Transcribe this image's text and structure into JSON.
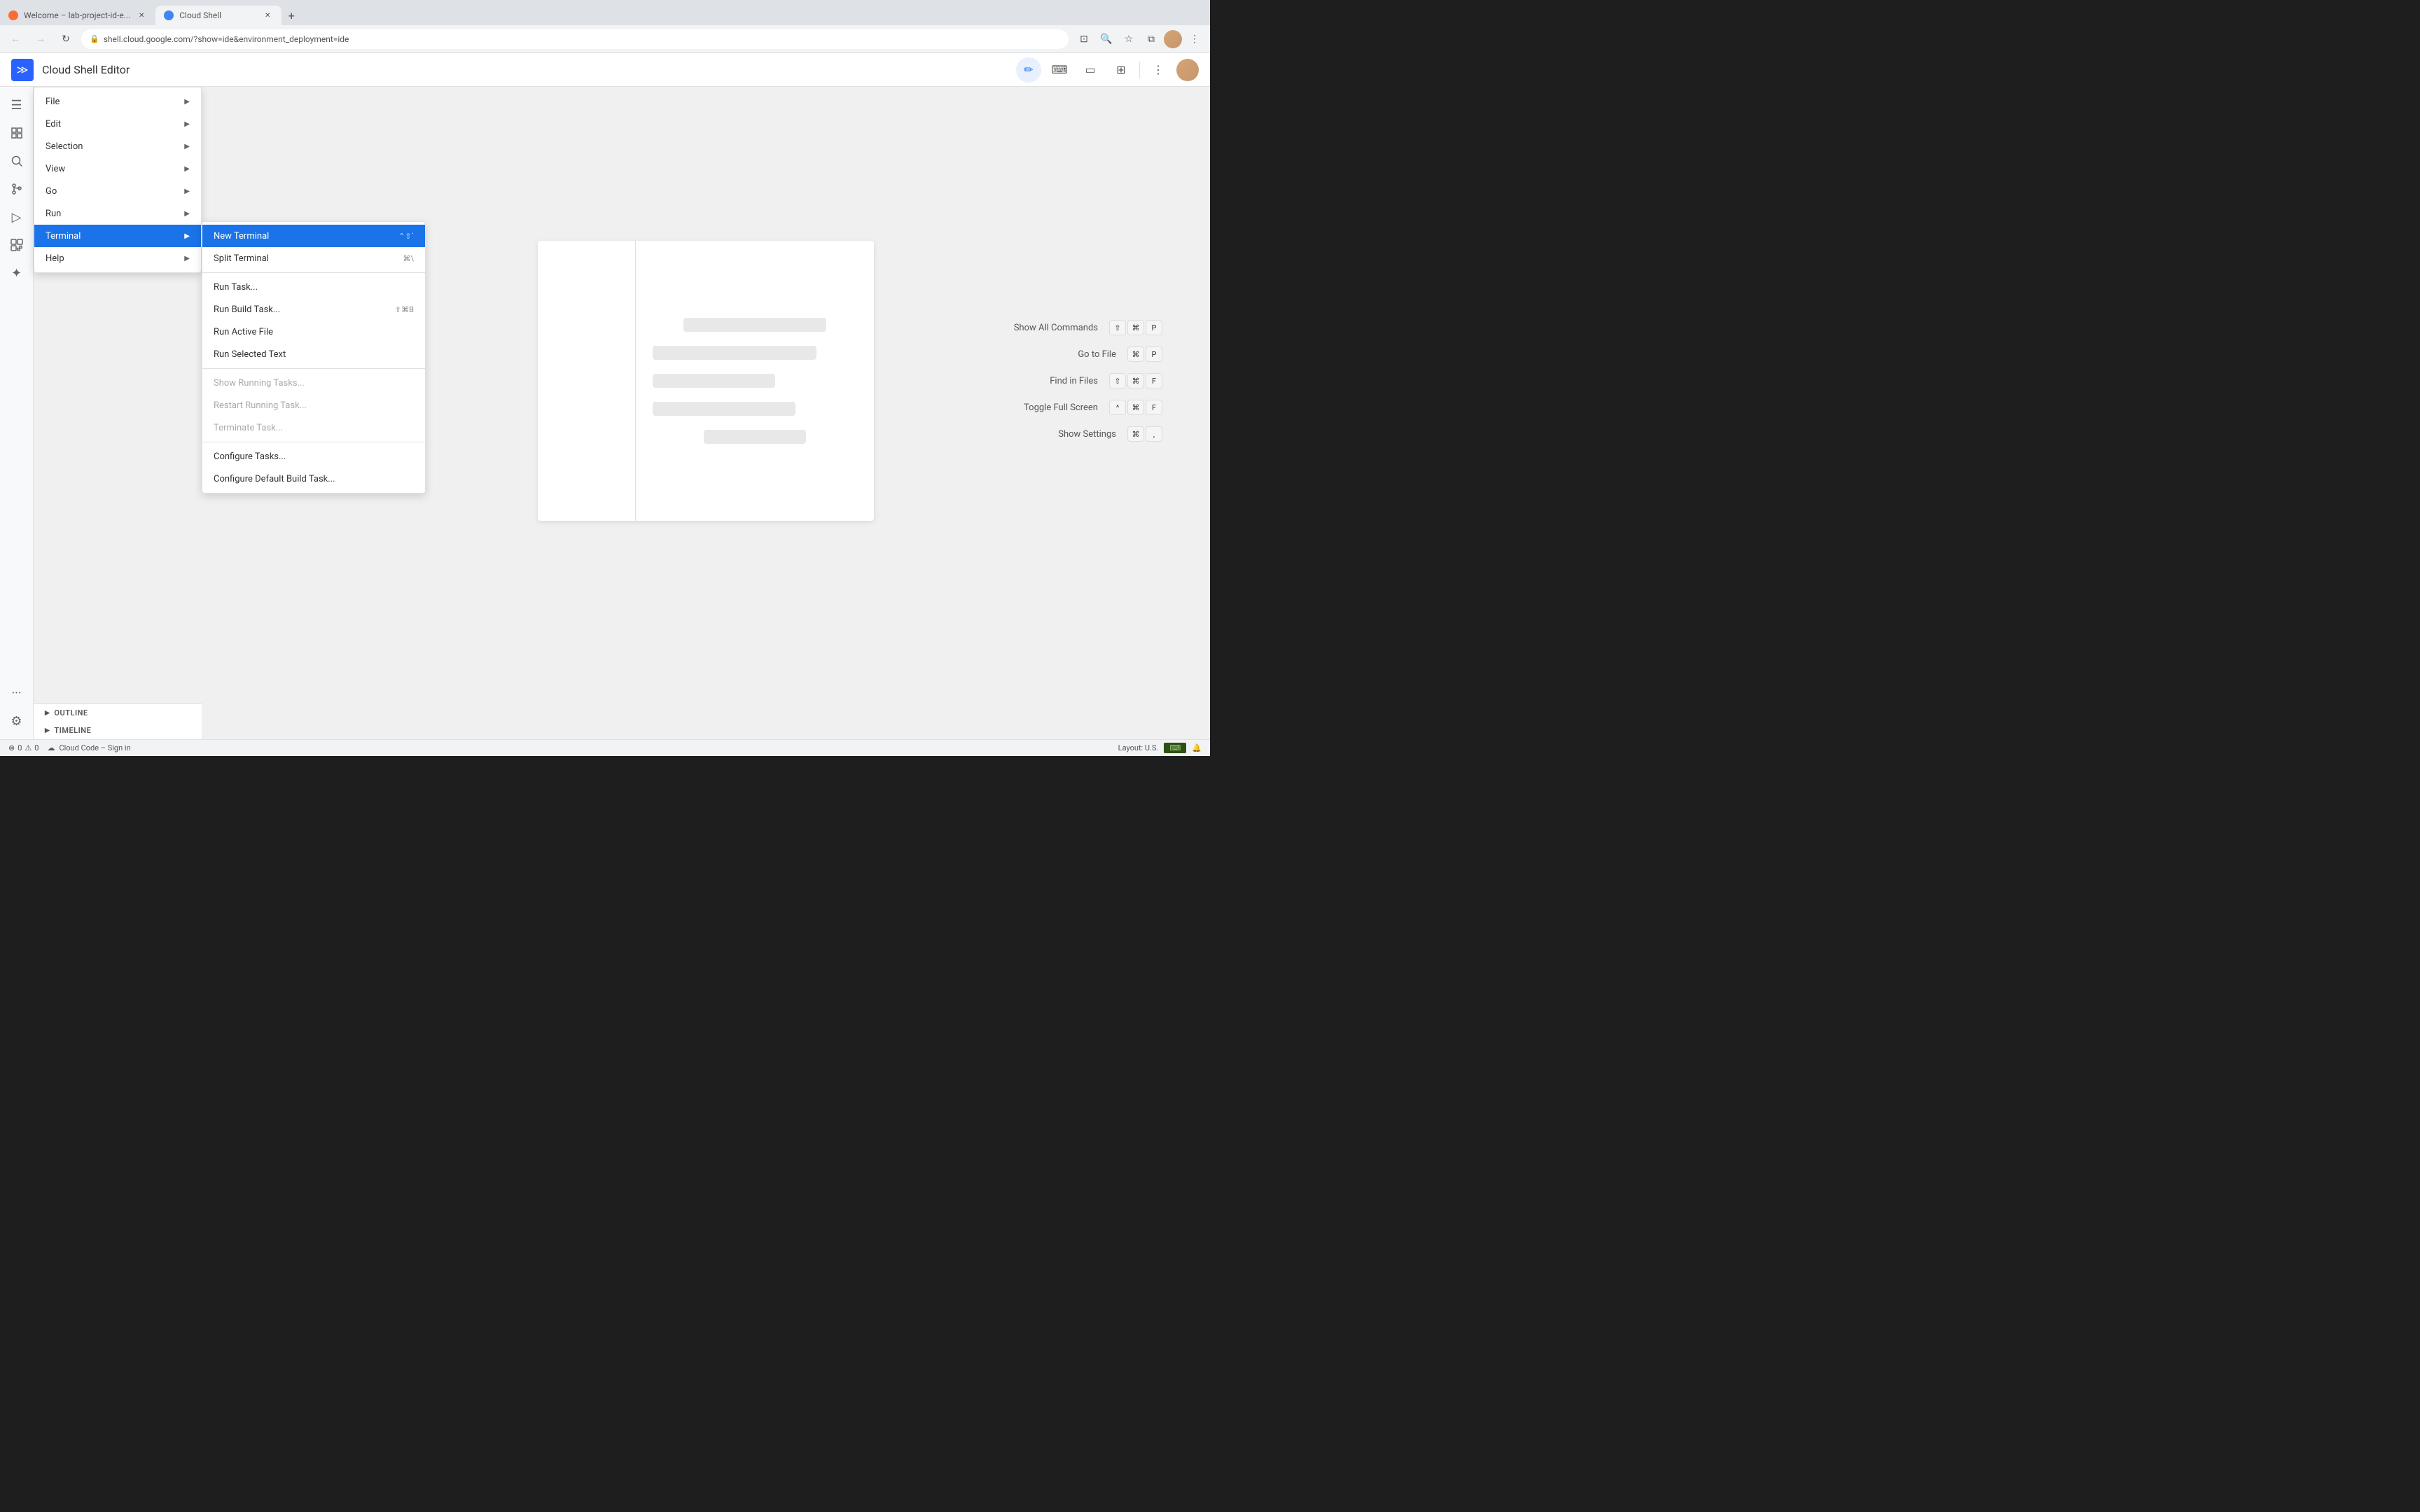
{
  "browser": {
    "tabs": [
      {
        "id": "tab1",
        "favicon": "orange",
        "title": "Welcome – lab-project-id-e...",
        "active": false
      },
      {
        "id": "tab2",
        "favicon": "cloud",
        "title": "Cloud Shell",
        "active": true
      }
    ],
    "new_tab_label": "+",
    "address": "shell.cloud.google.com/?show=ide&environment_deployment=ide",
    "nav": {
      "back": "←",
      "forward": "→",
      "reload": "↻"
    },
    "toolbar_icons": [
      "download-icon",
      "search-icon",
      "star-icon",
      "extensions-icon",
      "account-icon",
      "more-icon"
    ]
  },
  "app": {
    "logo_icon": "≫",
    "title": "Cloud Shell Editor",
    "header_buttons": {
      "edit": "✏",
      "terminal": "⌨",
      "preview": "▭",
      "layout": "⊞",
      "more": "⋮"
    }
  },
  "activity_bar": {
    "items": [
      {
        "id": "menu",
        "icon": "☰",
        "label": "menu-icon"
      },
      {
        "id": "explorer",
        "icon": "⧉",
        "label": "explorer-icon"
      },
      {
        "id": "search",
        "icon": "🔍",
        "label": "search-icon"
      },
      {
        "id": "source-control",
        "icon": "⑂",
        "label": "source-control-icon"
      },
      {
        "id": "run",
        "icon": "▷",
        "label": "run-icon"
      },
      {
        "id": "extensions",
        "icon": "⊞",
        "label": "extensions-icon"
      },
      {
        "id": "gemini",
        "icon": "✦",
        "label": "gemini-icon"
      },
      {
        "id": "more",
        "icon": "···",
        "label": "more-icon"
      }
    ],
    "bottom_items": [
      {
        "id": "settings",
        "icon": "⚙",
        "label": "settings-icon"
      }
    ]
  },
  "menu": {
    "primary": {
      "items": [
        {
          "id": "file",
          "label": "File",
          "has_submenu": true
        },
        {
          "id": "edit",
          "label": "Edit",
          "has_submenu": true
        },
        {
          "id": "selection",
          "label": "Selection",
          "has_submenu": true
        },
        {
          "id": "view",
          "label": "View",
          "has_submenu": true
        },
        {
          "id": "go",
          "label": "Go",
          "has_submenu": true
        },
        {
          "id": "run",
          "label": "Run",
          "has_submenu": true
        },
        {
          "id": "terminal",
          "label": "Terminal",
          "has_submenu": true,
          "active": true
        },
        {
          "id": "help",
          "label": "Help",
          "has_submenu": true
        }
      ]
    },
    "terminal_submenu": {
      "items": [
        {
          "id": "new-terminal",
          "label": "New Terminal",
          "shortcut": "⌃⇧`",
          "active": true
        },
        {
          "id": "split-terminal",
          "label": "Split Terminal",
          "shortcut": "⌘\\"
        },
        {
          "id": "divider1",
          "type": "divider"
        },
        {
          "id": "run-task",
          "label": "Run Task..."
        },
        {
          "id": "run-build-task",
          "label": "Run Build Task...",
          "shortcut": "⇧⌘B"
        },
        {
          "id": "run-active-file",
          "label": "Run Active File"
        },
        {
          "id": "run-selected-text",
          "label": "Run Selected Text"
        },
        {
          "id": "divider2",
          "type": "divider"
        },
        {
          "id": "show-running-tasks",
          "label": "Show Running Tasks...",
          "disabled": true
        },
        {
          "id": "restart-running-task",
          "label": "Restart Running Task...",
          "disabled": true
        },
        {
          "id": "terminate-task",
          "label": "Terminate Task...",
          "disabled": true
        },
        {
          "id": "divider3",
          "type": "divider"
        },
        {
          "id": "configure-tasks",
          "label": "Configure Tasks..."
        },
        {
          "id": "configure-default-build",
          "label": "Configure Default Build Task..."
        }
      ]
    }
  },
  "shortcuts": [
    {
      "id": "show-all-commands",
      "name": "Show All Commands",
      "keys": [
        "⇧",
        "⌘",
        "P"
      ]
    },
    {
      "id": "go-to-file",
      "name": "Go to File",
      "keys": [
        "⌘",
        "P"
      ]
    },
    {
      "id": "find-in-files",
      "name": "Find in Files",
      "keys": [
        "⇧",
        "⌘",
        "F"
      ]
    },
    {
      "id": "toggle-fullscreen",
      "name": "Toggle Full Screen",
      "keys": [
        "^",
        "⌘",
        "F"
      ]
    },
    {
      "id": "show-settings",
      "name": "Show Settings",
      "keys": [
        "⌘",
        ","
      ]
    }
  ],
  "sidebar_bottom": {
    "outline_label": "OUTLINE",
    "timeline_label": "TIMELINE"
  },
  "status_bar": {
    "error_count": "0",
    "warning_count": "0",
    "cloud_code": "Cloud Code – Sign in",
    "layout": "Layout: U.S.",
    "notification_icon": "🔔"
  }
}
